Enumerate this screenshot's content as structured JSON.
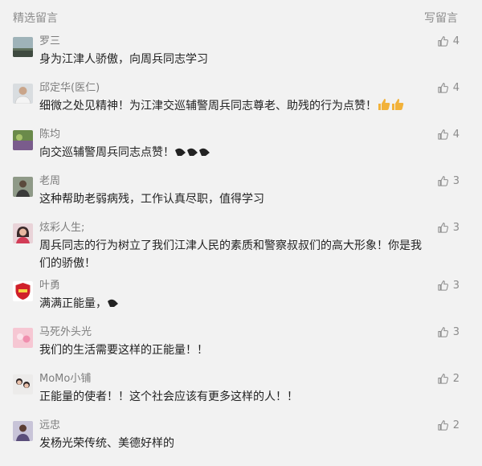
{
  "header": {
    "title": "精选留言",
    "write_label": "写留言"
  },
  "comments": [
    {
      "nick": "罗三",
      "text": "身为江津人骄傲，向周兵同志学习",
      "likes": "4",
      "avatar": "landscape-avatar"
    },
    {
      "nick": "邱定华(医仁)",
      "text": "细微之处见精神！为江津交巡辅警周兵同志尊老、助残的行为点赞！",
      "likes": "4",
      "avatar": "doctor-avatar",
      "emoji": "thumbs-up-emoji"
    },
    {
      "nick": "陈均",
      "text": "向交巡辅警周兵同志点赞！",
      "likes": "4",
      "avatar": "field-avatar",
      "emoji": "fist-emoji"
    },
    {
      "nick": "老周",
      "text": "这种帮助老弱病残，工作认真尽职，值得学习",
      "likes": "3",
      "avatar": "person-avatar"
    },
    {
      "nick": "炫彩人生;",
      "text": "周兵同志的行为树立了我们江津人民的素质和警察叔叔们的高大形象！你是我们的骄傲！",
      "likes": "3",
      "avatar": "woman-avatar"
    },
    {
      "nick": "叶勇",
      "text": "满满正能量，",
      "likes": "3",
      "avatar": "shield-avatar",
      "emoji": "fist-emoji"
    },
    {
      "nick": "马死外头光",
      "text": "我们的生活需要这样的正能量！！",
      "likes": "3",
      "avatar": "pink-avatar"
    },
    {
      "nick": "MoMo小铺",
      "text": "正能量的使者！！这个社会应该有更多这样的人！！",
      "likes": "2",
      "avatar": "girls-avatar"
    },
    {
      "nick": "远忠",
      "text": "发杨光荣传统、美德好样的",
      "likes": "2",
      "avatar": "man-avatar"
    }
  ],
  "colors": {
    "background": "#f2f2f2",
    "meta_text": "#8c8c8c",
    "body_text": "#222222"
  }
}
